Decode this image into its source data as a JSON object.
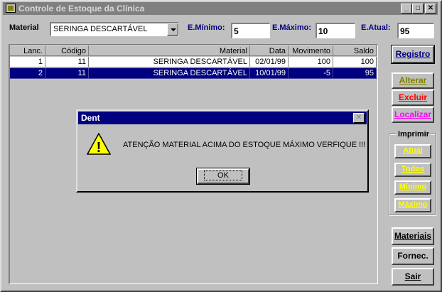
{
  "window": {
    "title": "Controle de Estoque da Clínica",
    "minimize_glyph": "_",
    "maximize_glyph": "□",
    "close_glyph": "✕"
  },
  "filters": {
    "material_label": "Material",
    "material_value": "SERINGA DESCARTÁVEL",
    "min_label": "E.Mínimo:",
    "min_value": "5",
    "max_label": "E.Máximo:",
    "max_value": "10",
    "atual_label": "E.Atual:",
    "atual_value": "95"
  },
  "grid": {
    "columns": [
      "Lanc.",
      "Código",
      "Material",
      "Data",
      "Movimento",
      "Saldo"
    ],
    "rows": [
      [
        "1",
        "11",
        "SERINGA DESCARTÁVEL",
        "02/01/99",
        "100",
        "100"
      ],
      [
        "2",
        "11",
        "SERINGA DESCARTÁVEL",
        "10/01/99",
        "-5",
        "95"
      ]
    ]
  },
  "buttons": {
    "registro": "Registro",
    "alterar": "Alterar",
    "excluir": "Excluir",
    "localizar": "Localizar",
    "materiais": "Materiais",
    "fornec": "Fornec.",
    "sair": "Sair"
  },
  "imprimir": {
    "title": "Imprimir",
    "atual": "Atual",
    "todos": "Todos",
    "minimo": "Mínimo",
    "maximo": "Máximo"
  },
  "dialog": {
    "title": "Dent",
    "close_glyph": "✕",
    "warning_glyph": "!",
    "message": "ATENÇÃO MATERIAL ACIMA DO ESTOQUE MÁXIMO VERFIQUE !!!",
    "ok": "OK"
  },
  "colors": {
    "window_bg": "#c0c0c0",
    "selection": "#000080",
    "registro_text": "#000080",
    "alterar_text": "#808000",
    "excluir_text": "#ff0000",
    "localizar_text": "#ff00ff",
    "print_text": "#ffff00",
    "warning_yellow": "#ffff00"
  }
}
